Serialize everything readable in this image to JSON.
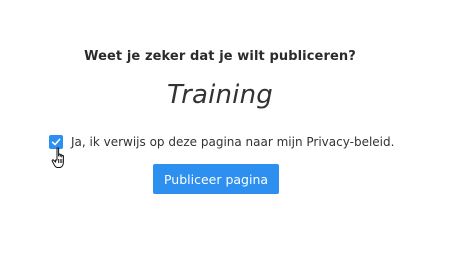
{
  "dialog": {
    "question": "Weet je zeker dat je wilt publiceren?",
    "page_name": "Training",
    "consent": {
      "checked": true,
      "label": "Ja, ik verwijs op deze pagina naar mijn Privacy-beleid."
    },
    "publish_button_label": "Publiceer pagina"
  },
  "colors": {
    "accent": "#2d8ff0",
    "text": "#333333",
    "background": "#ffffff"
  },
  "icons": {
    "checkbox": "checkmark-icon",
    "cursor": "hand-pointer-icon"
  }
}
